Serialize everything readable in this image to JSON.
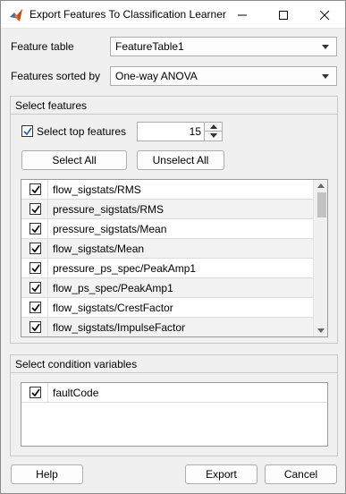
{
  "window": {
    "title": "Export Features To Classification Learner",
    "icon": "matlab-icon"
  },
  "feature_table": {
    "label": "Feature table",
    "value": "FeatureTable1"
  },
  "sort": {
    "label": "Features sorted by",
    "value": "One-way ANOVA"
  },
  "select_features": {
    "title": "Select features",
    "top_label": "Select top features",
    "top_checked": true,
    "top_count": "15",
    "select_all": "Select All",
    "unselect_all": "Unselect All",
    "features": [
      {
        "name": "flow_sigstats/RMS",
        "checked": true
      },
      {
        "name": "pressure_sigstats/RMS",
        "checked": true
      },
      {
        "name": "pressure_sigstats/Mean",
        "checked": true
      },
      {
        "name": "flow_sigstats/Mean",
        "checked": true
      },
      {
        "name": "pressure_ps_spec/PeakAmp1",
        "checked": true
      },
      {
        "name": "flow_ps_spec/PeakAmp1",
        "checked": true
      },
      {
        "name": "flow_sigstats/CrestFactor",
        "checked": true
      },
      {
        "name": "flow_sigstats/ImpulseFactor",
        "checked": true
      }
    ]
  },
  "conditions": {
    "title": "Select condition variables",
    "variables": [
      {
        "name": "faultCode",
        "checked": true
      }
    ]
  },
  "footer": {
    "help": "Help",
    "export": "Export",
    "cancel": "Cancel"
  }
}
